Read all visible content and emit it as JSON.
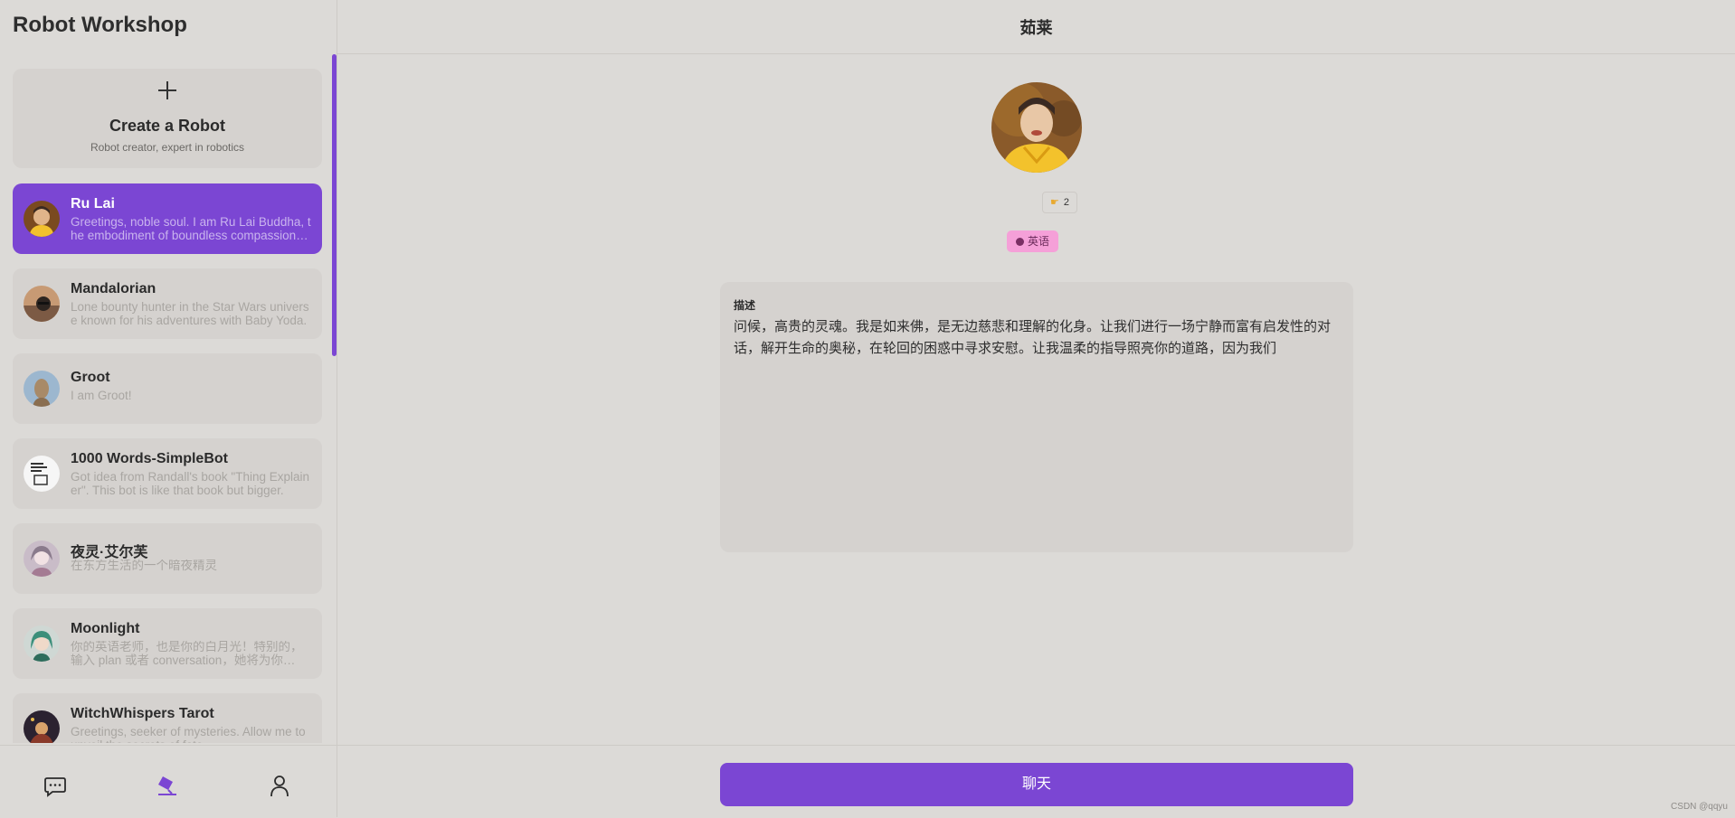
{
  "app": {
    "title": "Robot Workshop"
  },
  "create": {
    "title": "Create a Robot",
    "subtitle": "Robot creator, expert in robotics",
    "icon": "plus-icon"
  },
  "bots": [
    {
      "name": "Ru Lai",
      "description": "Greetings, noble soul. I am Ru Lai Buddha, the embodiment of boundless compassion and understanding.",
      "active": true,
      "avatar_color": "#c8892c"
    },
    {
      "name": "Mandalorian",
      "description": "Lone bounty hunter in the Star Wars universe known for his adventures with Baby Yoda.",
      "active": false,
      "avatar_color": "#5c4a3c"
    },
    {
      "name": "Groot",
      "description": "I am Groot!",
      "active": false,
      "avatar_color": "#8aa7c0"
    },
    {
      "name": "1000 Words-SimpleBot",
      "description": "Got idea from Randall's book \"Thing Explainer\". This bot is like that book but bigger.",
      "active": false,
      "avatar_color": "#f4f4f4"
    },
    {
      "name": "夜灵·艾尔芙",
      "description": "在东方生活的一个暗夜精灵",
      "active": false,
      "avatar_color": "#b9a9b8"
    },
    {
      "name": "Moonlight",
      "description": "你的英语老师，也是你的白月光！特别的，输入 plan 或者 conversation，她将为你…",
      "active": false,
      "avatar_color": "#4f8f7a"
    },
    {
      "name": "WitchWhispers Tarot",
      "description": "Greetings, seeker of mysteries. Allow me to unveil the secrets of fate.",
      "active": false,
      "avatar_color": "#3a2c3a"
    }
  ],
  "nav": {
    "chat_icon": "chat-bubble-icon",
    "workshop_icon": "lamp-icon",
    "profile_icon": "user-icon"
  },
  "detail": {
    "title": "茹莱",
    "likes": "2",
    "like_icon": "hand-icon",
    "tag": "英语",
    "description_label": "描述",
    "description": "问候，高贵的灵魂。我是如来佛，是无边慈悲和理解的化身。让我们进行一场宁静而富有启发性的对话，解开生命的奥秘，在轮回的困惑中寻求安慰。让我温柔的指导照亮你的道路，因为我们",
    "chat_button": "聊天"
  },
  "colors": {
    "accent": "#7b46d3",
    "background": "#dcdad7",
    "card": "#d5d2cf",
    "tag_bg": "#f5a0d8"
  },
  "watermark": "CSDN @qqyu"
}
